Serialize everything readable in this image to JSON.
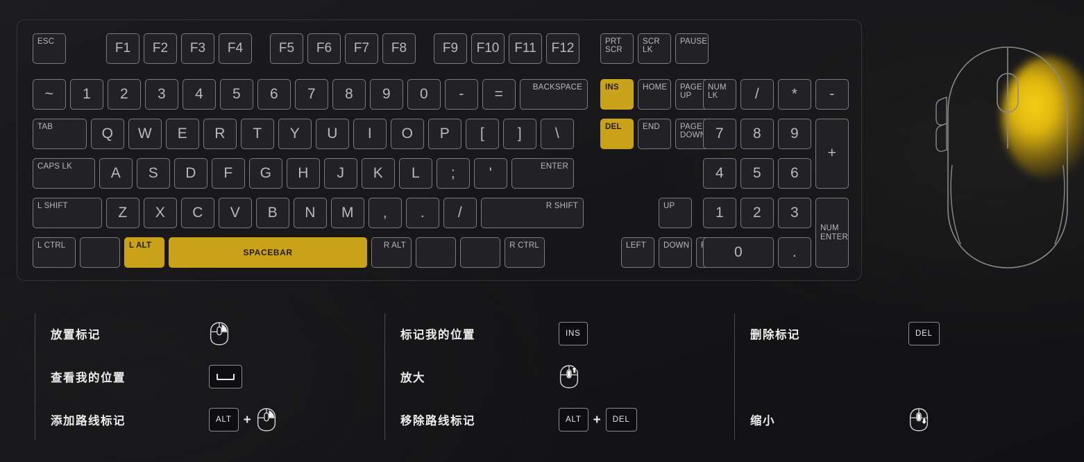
{
  "colors": {
    "background": "#1a1a1c",
    "key_border": "#7c7c80",
    "key_face": "#222226",
    "key_text": "#b9b9bb",
    "highlight": "#c9a21a",
    "highlight_text": "#231c02",
    "legend_text": "#ececec",
    "divider": "#4a4a4e",
    "mouse_outline": "#8a8a8e",
    "mouse_glow": "#f5cf14"
  },
  "keyboard": {
    "rows": {
      "function": [
        {
          "label": "ESC",
          "align": "tl",
          "highlight": false
        },
        {
          "label": "F1",
          "align": "fn",
          "highlight": false
        },
        {
          "label": "F2",
          "align": "fn",
          "highlight": false
        },
        {
          "label": "F3",
          "align": "fn",
          "highlight": false
        },
        {
          "label": "F4",
          "align": "fn",
          "highlight": false
        },
        {
          "label": "F5",
          "align": "fn",
          "highlight": false
        },
        {
          "label": "F6",
          "align": "fn",
          "highlight": false
        },
        {
          "label": "F7",
          "align": "fn",
          "highlight": false
        },
        {
          "label": "F8",
          "align": "fn",
          "highlight": false
        },
        {
          "label": "F9",
          "align": "fn",
          "highlight": false
        },
        {
          "label": "F10",
          "align": "fn",
          "highlight": false
        },
        {
          "label": "F11",
          "align": "fn",
          "highlight": false
        },
        {
          "label": "F12",
          "align": "fn",
          "highlight": false
        }
      ],
      "number": [
        {
          "label": "~",
          "align": "c",
          "highlight": false
        },
        {
          "label": "1",
          "align": "c",
          "highlight": false
        },
        {
          "label": "2",
          "align": "c",
          "highlight": false
        },
        {
          "label": "3",
          "align": "c",
          "highlight": false
        },
        {
          "label": "4",
          "align": "c",
          "highlight": false
        },
        {
          "label": "5",
          "align": "c",
          "highlight": false
        },
        {
          "label": "6",
          "align": "c",
          "highlight": false
        },
        {
          "label": "7",
          "align": "c",
          "highlight": false
        },
        {
          "label": "8",
          "align": "c",
          "highlight": false
        },
        {
          "label": "9",
          "align": "c",
          "highlight": false
        },
        {
          "label": "0",
          "align": "c",
          "highlight": false
        },
        {
          "label": "-",
          "align": "c",
          "highlight": false
        },
        {
          "label": "=",
          "align": "c",
          "highlight": false
        },
        {
          "label": "BACKSPACE",
          "align": "tr",
          "highlight": false
        }
      ],
      "top": [
        {
          "label": "TAB",
          "align": "tl",
          "highlight": false
        },
        {
          "label": "Q",
          "align": "c",
          "highlight": false
        },
        {
          "label": "W",
          "align": "c",
          "highlight": false
        },
        {
          "label": "E",
          "align": "c",
          "highlight": false
        },
        {
          "label": "R",
          "align": "c",
          "highlight": false
        },
        {
          "label": "T",
          "align": "c",
          "highlight": false
        },
        {
          "label": "Y",
          "align": "c",
          "highlight": false
        },
        {
          "label": "U",
          "align": "c",
          "highlight": false
        },
        {
          "label": "I",
          "align": "c",
          "highlight": false
        },
        {
          "label": "O",
          "align": "c",
          "highlight": false
        },
        {
          "label": "P",
          "align": "c",
          "highlight": false
        },
        {
          "label": "[",
          "align": "c",
          "highlight": false
        },
        {
          "label": "]",
          "align": "c",
          "highlight": false
        },
        {
          "label": "\\",
          "align": "c",
          "highlight": false
        }
      ],
      "home": [
        {
          "label": "CAPS LK",
          "align": "tl",
          "highlight": false
        },
        {
          "label": "A",
          "align": "c",
          "highlight": false
        },
        {
          "label": "S",
          "align": "c",
          "highlight": false
        },
        {
          "label": "D",
          "align": "c",
          "highlight": false
        },
        {
          "label": "F",
          "align": "c",
          "highlight": false
        },
        {
          "label": "G",
          "align": "c",
          "highlight": false
        },
        {
          "label": "H",
          "align": "c",
          "highlight": false
        },
        {
          "label": "J",
          "align": "c",
          "highlight": false
        },
        {
          "label": "K",
          "align": "c",
          "highlight": false
        },
        {
          "label": "L",
          "align": "c",
          "highlight": false
        },
        {
          "label": ";",
          "align": "c",
          "highlight": false
        },
        {
          "label": "'",
          "align": "c",
          "highlight": false
        },
        {
          "label": "ENTER",
          "align": "tr",
          "highlight": false
        }
      ],
      "bottom": [
        {
          "label": "L SHIFT",
          "align": "tl",
          "highlight": false
        },
        {
          "label": "Z",
          "align": "c",
          "highlight": false
        },
        {
          "label": "X",
          "align": "c",
          "highlight": false
        },
        {
          "label": "C",
          "align": "c",
          "highlight": false
        },
        {
          "label": "V",
          "align": "c",
          "highlight": false
        },
        {
          "label": "B",
          "align": "c",
          "highlight": false
        },
        {
          "label": "N",
          "align": "c",
          "highlight": false
        },
        {
          "label": "M",
          "align": "c",
          "highlight": false
        },
        {
          "label": ",",
          "align": "c",
          "highlight": false
        },
        {
          "label": ".",
          "align": "c",
          "highlight": false
        },
        {
          "label": "/",
          "align": "c",
          "highlight": false
        },
        {
          "label": "R SHIFT",
          "align": "tr",
          "highlight": false
        }
      ],
      "modifier": [
        {
          "label": "L CTRL",
          "align": "tl",
          "highlight": false
        },
        {
          "label": "",
          "align": "tl",
          "highlight": false
        },
        {
          "label": "L ALT",
          "align": "tl",
          "highlight": true
        },
        {
          "label": "SPACEBAR",
          "align": "spaceb",
          "highlight": true
        },
        {
          "label": "R ALT",
          "align": "tr",
          "highlight": false
        },
        {
          "label": "",
          "align": "tr",
          "highlight": false
        },
        {
          "label": "",
          "align": "tr",
          "highlight": false
        },
        {
          "label": "R CTRL",
          "align": "tr",
          "highlight": false
        }
      ],
      "nav": [
        {
          "label": "PRT\nSCR",
          "align": "tl",
          "highlight": false
        },
        {
          "label": "SCR\nLK",
          "align": "tl",
          "highlight": false
        },
        {
          "label": "PAUSE",
          "align": "tl",
          "highlight": false
        },
        {
          "label": "INS",
          "align": "tl",
          "highlight": true
        },
        {
          "label": "HOME",
          "align": "tl",
          "highlight": false
        },
        {
          "label": "PAGE\nUP",
          "align": "tl",
          "highlight": false
        },
        {
          "label": "DEL",
          "align": "tl",
          "highlight": true
        },
        {
          "label": "END",
          "align": "tl",
          "highlight": false
        },
        {
          "label": "PAGE\nDOWN",
          "align": "tl",
          "highlight": false
        }
      ],
      "arrows": [
        {
          "label": "UP",
          "align": "tl",
          "highlight": false
        },
        {
          "label": "LEFT",
          "align": "tl",
          "highlight": false
        },
        {
          "label": "DOWN",
          "align": "tl",
          "highlight": false
        },
        {
          "label": "RIGHT",
          "align": "tl",
          "highlight": false
        }
      ],
      "numpad": [
        {
          "label": "NUM\nLK",
          "align": "tl",
          "highlight": false
        },
        {
          "label": "/",
          "align": "c",
          "highlight": false
        },
        {
          "label": "*",
          "align": "c",
          "highlight": false
        },
        {
          "label": "-",
          "align": "c",
          "highlight": false
        },
        {
          "label": "7",
          "align": "c",
          "highlight": false
        },
        {
          "label": "8",
          "align": "c",
          "highlight": false
        },
        {
          "label": "9",
          "align": "c",
          "highlight": false
        },
        {
          "label": "+",
          "align": "c",
          "highlight": false
        },
        {
          "label": "4",
          "align": "c",
          "highlight": false
        },
        {
          "label": "5",
          "align": "c",
          "highlight": false
        },
        {
          "label": "6",
          "align": "c",
          "highlight": false
        },
        {
          "label": "1",
          "align": "c",
          "highlight": false
        },
        {
          "label": "2",
          "align": "c",
          "highlight": false
        },
        {
          "label": "3",
          "align": "c",
          "highlight": false
        },
        {
          "label": "NUM\nENTER",
          "align": "mid",
          "highlight": false
        },
        {
          "label": "0",
          "align": "c",
          "highlight": false
        },
        {
          "label": ".",
          "align": "c",
          "highlight": false
        }
      ]
    }
  },
  "legend": {
    "columns": [
      {
        "rows": [
          {
            "label": "放置标记",
            "binding": [
              {
                "type": "mouse",
                "icon": "mouse-right-click-icon"
              }
            ]
          },
          {
            "label": "查看我的位置",
            "binding": [
              {
                "type": "space",
                "icon": "spacebar-key-icon",
                "text": ""
              }
            ]
          },
          {
            "label": "添加路线标记",
            "binding": [
              {
                "type": "key",
                "text": "ALT"
              },
              {
                "type": "plus",
                "text": "+"
              },
              {
                "type": "mouse",
                "icon": "mouse-right-click-icon"
              }
            ]
          }
        ]
      },
      {
        "rows": [
          {
            "label": "标记我的位置",
            "binding": [
              {
                "type": "key",
                "text": "INS"
              }
            ]
          },
          {
            "label": "放大",
            "binding": [
              {
                "type": "mouse",
                "icon": "mouse-scroll-up-icon"
              }
            ]
          },
          {
            "label": "移除路线标记",
            "binding": [
              {
                "type": "key",
                "text": "ALT"
              },
              {
                "type": "plus",
                "text": "+"
              },
              {
                "type": "key",
                "text": "DEL"
              }
            ]
          }
        ]
      },
      {
        "rows": [
          {
            "label": "删除标记",
            "binding": [
              {
                "type": "key",
                "text": "DEL"
              }
            ]
          },
          {
            "label": "缩小",
            "binding": [
              {
                "type": "mouse",
                "icon": "mouse-scroll-down-icon"
              }
            ]
          }
        ]
      }
    ]
  },
  "mouse_diagram": {
    "highlight_regions": [
      "right-button",
      "scroll-wheel"
    ],
    "side_buttons": 2
  }
}
